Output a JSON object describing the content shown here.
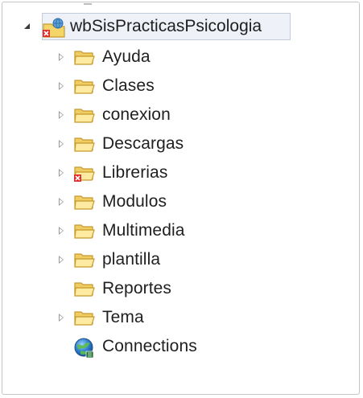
{
  "project": {
    "name": "wbSisPracticasPsicologia",
    "icon": "web-project-error-icon",
    "expanded": true
  },
  "items": [
    {
      "label": "Ayuda",
      "icon": "folder-icon",
      "expandable": true
    },
    {
      "label": "Clases",
      "icon": "folder-icon",
      "expandable": true
    },
    {
      "label": "conexion",
      "icon": "folder-icon",
      "expandable": true
    },
    {
      "label": "Descargas",
      "icon": "folder-icon",
      "expandable": true
    },
    {
      "label": "Librerias",
      "icon": "folder-error-icon",
      "expandable": true
    },
    {
      "label": "Modulos",
      "icon": "folder-icon",
      "expandable": true
    },
    {
      "label": "Multimedia",
      "icon": "folder-icon",
      "expandable": true
    },
    {
      "label": "plantilla",
      "icon": "folder-icon",
      "expandable": true
    },
    {
      "label": "Reportes",
      "icon": "folder-icon",
      "expandable": false
    },
    {
      "label": "Tema",
      "icon": "folder-icon",
      "expandable": true
    },
    {
      "label": "Connections",
      "icon": "globe-connections-icon",
      "expandable": false
    }
  ],
  "colors": {
    "folder_fill": "#f4d56a",
    "folder_stroke": "#c59a2b",
    "selection_bg": "#eef2f8",
    "selection_border": "#c2cbd9",
    "error_red": "#e12d2d"
  }
}
